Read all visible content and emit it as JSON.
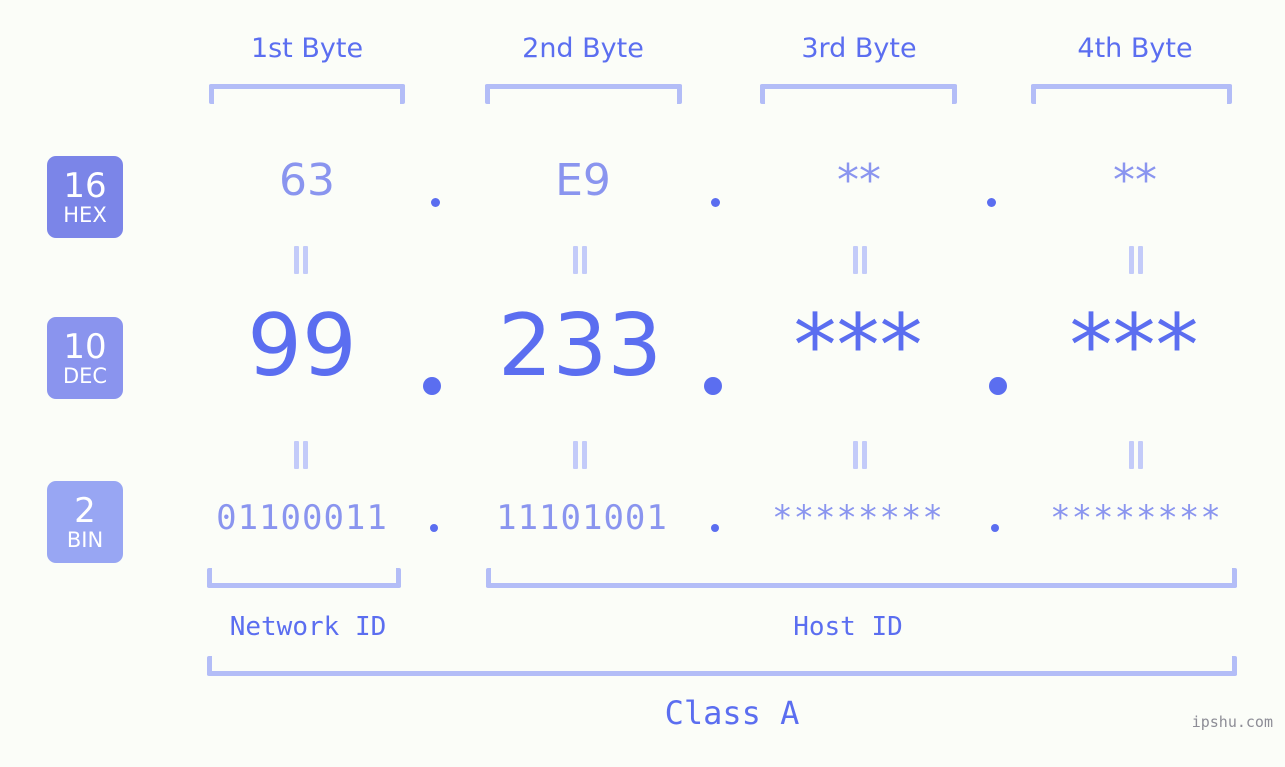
{
  "meta": {
    "background_color": "#fbfdf8",
    "accent_color": "#5b6ef0",
    "accent_light_color": "#8a95ef",
    "bracket_color": "#b3bdf7",
    "watermark": "ipshu.com"
  },
  "byte_headers": [
    {
      "label": "1st Byte"
    },
    {
      "label": "2nd Byte"
    },
    {
      "label": "3rd Byte"
    },
    {
      "label": "4th Byte"
    }
  ],
  "bases": [
    {
      "number": "16",
      "name": "HEX",
      "color": "#7b85e8"
    },
    {
      "number": "10",
      "name": "DEC",
      "color": "#8a94ee"
    },
    {
      "number": "2",
      "name": "BIN",
      "color": "#98a6f3"
    }
  ],
  "rows": {
    "hex": {
      "values": [
        "63",
        "E9",
        "**",
        "**"
      ],
      "separator": "."
    },
    "dec": {
      "values": [
        "99",
        "233",
        "***",
        "***"
      ],
      "separator": "."
    },
    "bin": {
      "values": [
        "01100011",
        "11101001",
        "********",
        "********"
      ],
      "separator": "."
    }
  },
  "equals_marks": {
    "symbol": "||"
  },
  "segments": {
    "network_id": "Network ID",
    "host_id": "Host ID",
    "class": "Class A"
  }
}
